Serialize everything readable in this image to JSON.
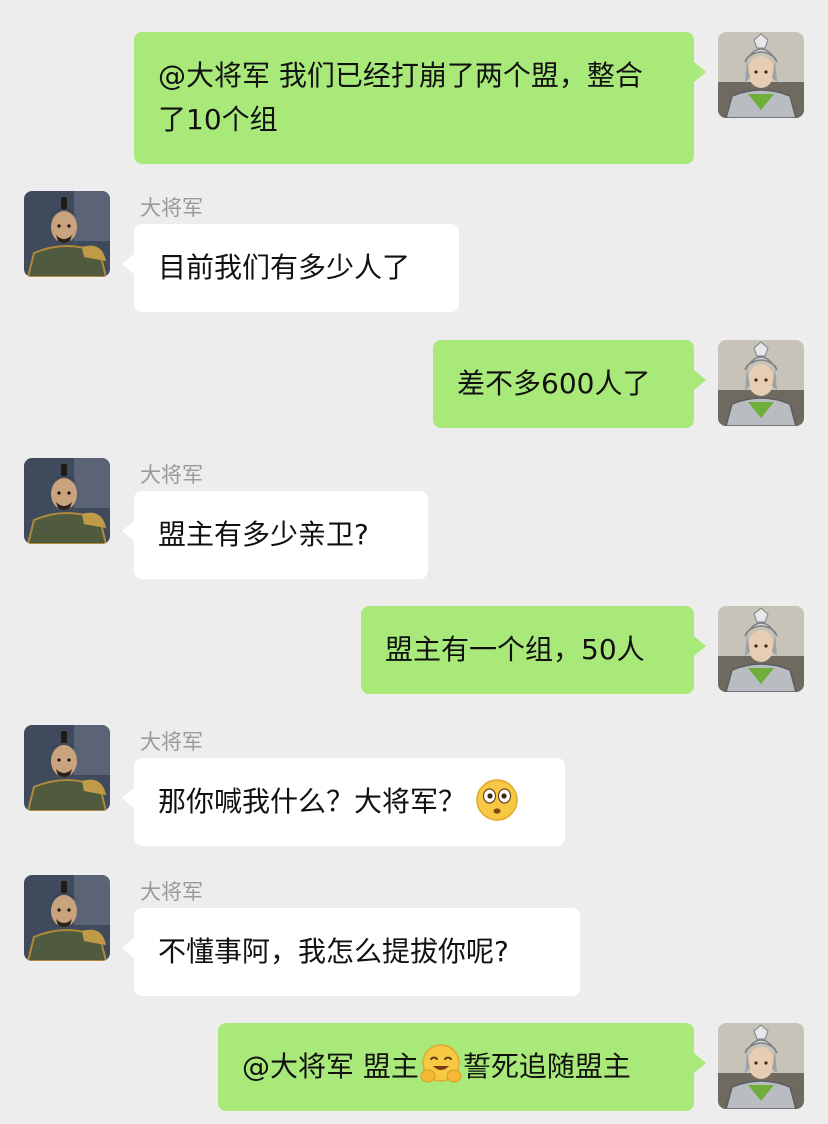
{
  "sender_name": "大将军",
  "messages": [
    {
      "from": "me",
      "text": "@大将军  我们已经打崩了两个盟，整合了10个组"
    },
    {
      "from": "them",
      "sender": "大将军",
      "text": "目前我们有多少人了"
    },
    {
      "from": "me",
      "text": "差不多600人了"
    },
    {
      "from": "them",
      "sender": "大将军",
      "text": "盟主有多少亲卫?"
    },
    {
      "from": "me",
      "text": "盟主有一个组，50人"
    },
    {
      "from": "them",
      "sender": "大将军",
      "text": "那你喊我什么？大将军？",
      "emoji": "flushed-face-emoji"
    },
    {
      "from": "them",
      "sender": "大将军",
      "text": "不懂事阿，我怎么提拔你呢?"
    },
    {
      "from": "me",
      "text_before": "@大将军  盟主",
      "emoji": "hugging-face-emoji",
      "text_after": "誓死追随盟主"
    }
  ],
  "colors": {
    "background": "#ededed",
    "my_bubble": "#a9e97a",
    "their_bubble": "#ffffff",
    "sender_name": "#9a9a9a"
  },
  "icons": {
    "my_avatar": "armored-warrior-avatar",
    "their_avatar": "general-avatar"
  }
}
